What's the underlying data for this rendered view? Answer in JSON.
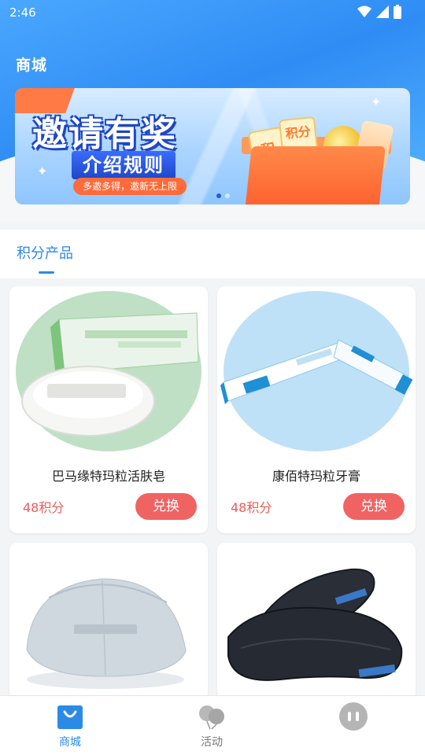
{
  "status_bar": {
    "time": "2:46"
  },
  "header": {
    "title": "商城"
  },
  "banner": {
    "title": "邀请有奖",
    "subtitle": "介绍规则",
    "tagline": "多邀多得，邀新无上限",
    "card_a_text": "积",
    "card_b_text": "积分",
    "slide_count": 2,
    "active_slide": 1
  },
  "section": {
    "tab_label": "积分产品"
  },
  "products": [
    {
      "name": "巴马缘特玛粒活肤皂",
      "points": "48积分",
      "action": "兑换",
      "image": "soap-product"
    },
    {
      "name": "康佰特玛粒牙膏",
      "points": "48积分",
      "action": "兑换",
      "image": "toothpaste-product"
    },
    {
      "name": "",
      "points": "",
      "action": "",
      "image": "cap-product"
    },
    {
      "name": "",
      "points": "",
      "action": "",
      "image": "eye-mask-product"
    }
  ],
  "bottom_nav": {
    "items": [
      {
        "label": "商城",
        "icon": "shop-bag-icon",
        "active": true
      },
      {
        "label": "活动",
        "icon": "balloons-icon",
        "active": false
      },
      {
        "label": "",
        "icon": "profile-icon",
        "active": false
      }
    ]
  },
  "colors": {
    "accent": "#2b8ae6",
    "price": "#ef5b5b",
    "exchange_button": "#f06363"
  }
}
